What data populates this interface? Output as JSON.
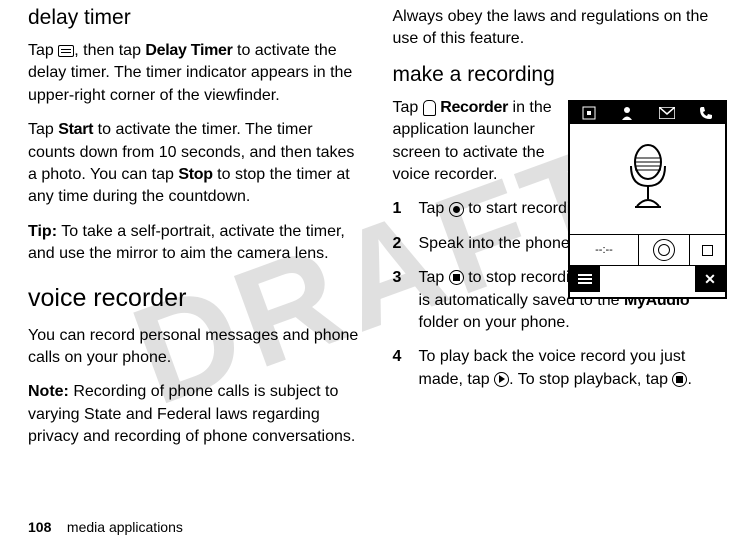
{
  "watermark": "DRAFT",
  "left": {
    "h_delay": "delay timer",
    "p1_a": "Tap ",
    "p1_b": ", then tap ",
    "p1_bold1": "Delay Timer",
    "p1_c": " to activate the delay timer. The timer indicator appears in the upper-right corner of the viewfinder.",
    "p2_a": "Tap ",
    "p2_bold1": "Start",
    "p2_b": " to activate the timer. The timer counts down from 10 seconds, and then takes a photo. You can tap ",
    "p2_bold2": "Stop",
    "p2_c": " to stop the timer at any time during the countdown.",
    "p3_lead": "Tip:",
    "p3": " To take a self-portrait, activate the timer, and use the mirror to aim the camera lens.",
    "h_voice": "voice recorder",
    "p4": "You can record personal messages and phone calls on your phone.",
    "p5_lead": "Note:",
    "p5": " Recording of phone calls is subject to varying State and Federal laws regarding privacy and recording of phone conversations."
  },
  "right": {
    "p0": "Always obey the laws and regulations on the use of this feature.",
    "h_make": "make a recording",
    "intro_a": "Tap ",
    "intro_bold": "Recorder",
    "intro_b": " in the application launcher screen to activate the voice recorder.",
    "steps": {
      "s1a": "Tap ",
      "s1b": " to start recording.",
      "s2": "Speak into the phone.",
      "s3a": "Tap ",
      "s3b": " to stop recording. The voice record is automatically saved to the ",
      "s3bold": "MyAudio",
      "s3c": " folder on your phone.",
      "s4a": "To play back the voice record you just made, tap ",
      "s4b": ". To stop playback, tap ",
      "s4c": "."
    },
    "drawing": {
      "time": "--:--"
    }
  },
  "footer": {
    "page": "108",
    "section": "media applications"
  }
}
